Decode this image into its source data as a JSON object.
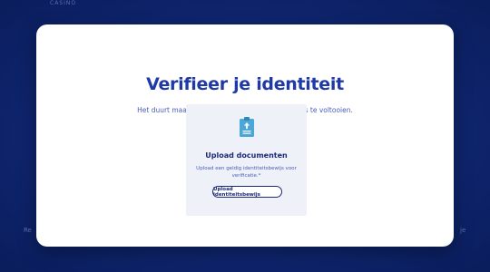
{
  "app": {
    "brand": "CASINO"
  },
  "background": {
    "left_text": "Re",
    "right_text": "je"
  },
  "modal": {
    "title": "Verifieer je identiteit",
    "subtitle": "Het duurt maar een paar seconden om het proces te voltooien."
  },
  "upload_card": {
    "icon": "document-upload-icon",
    "title": "Upload documenten",
    "description": "Upload een geldig identiteitsbewijs voor verificatie.*",
    "button_label": "Upload identiteitsbewijs"
  },
  "colors": {
    "accent": "#1f3aa8",
    "backdrop": "#0f2670",
    "icon": "#4aa8d8"
  }
}
